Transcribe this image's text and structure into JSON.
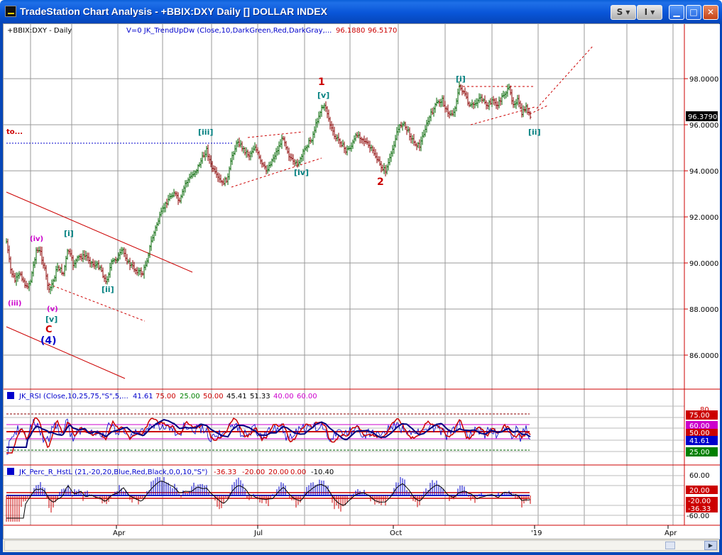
{
  "window": {
    "title": "TradeStation Chart Analysis - +BBIX:DXY Daily [] DOLLAR INDEX",
    "btn_s": "S",
    "btn_i": "I",
    "min_glyph": "▁",
    "max_glyph": "□",
    "close_glyph": "✕"
  },
  "main": {
    "symbol_label": "+BBIX:DXY - Daily",
    "indicator_label": "V=0  JK_TrendUpDw (Close,10,DarkGreen,Red,DarkGray,...",
    "indicator_v1": "96.1880",
    "indicator_v2": "96.5170",
    "target_label": "to...",
    "last_price": "96.3790",
    "price_ticks": [
      "98.0000",
      "96.0000",
      "94.0000",
      "92.0000",
      "90.0000",
      "88.0000",
      "86.0000"
    ],
    "wave_labels": {
      "w1": "1",
      "w2": "2",
      "wv_top": "[v]",
      "wiii": "[iii]",
      "wiv": "[iv]",
      "wi_top": "[i]",
      "wii_top": "[ii]",
      "wi_left": "[i]",
      "wii_left": "[ii]",
      "w_iv": "(iv)",
      "w_iii": "(iii)",
      "w_v": "(v)",
      "w_v_bracket": "[v]",
      "wC": "C",
      "w4": "(4)"
    }
  },
  "rsi": {
    "label": "JK_RSI (Close,10,25,75,\"S\",5,...",
    "v1": "41.61",
    "v2": "75.00",
    "v3": "25.00",
    "v4": "50.00",
    "v5": "45.41",
    "v6": "51.33",
    "v7": "40.00",
    "v8": "60.00",
    "tag_75": "75.00",
    "tag_60": "60.00",
    "tag_50": "50.00",
    "tag_4161": "41.61",
    "tag_25": "25.00",
    "tick_80": "80"
  },
  "percr": {
    "label": "JK_Perc_R_HstL (21,-20,20,Blue,Red,Black,0,0,10,\"S\")",
    "v1": "-36.33",
    "v2": "-20.00",
    "v3": "20.00",
    "v4": "0.00",
    "v5": "-10.40",
    "tick_60": "60.00",
    "tag_20": "20.00",
    "tag_m20": "-20.00",
    "tag_m3633": "-36.33",
    "tick_m60": "-60.00"
  },
  "xaxis": {
    "labels": [
      "Apr",
      "Jul",
      "Oct",
      "'19",
      "Apr"
    ]
  },
  "colors": {
    "bull": "#006400",
    "bear": "#8b0000",
    "trend": "#cc0000",
    "rsi_blue": "#0000cc",
    "teal": "#008080",
    "magenta": "#cc00cc"
  }
}
